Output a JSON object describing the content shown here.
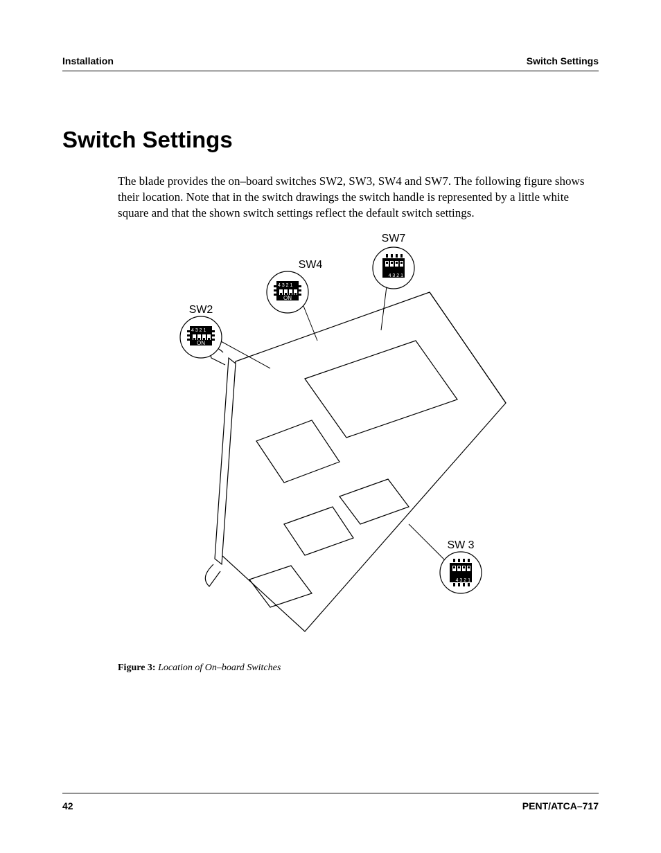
{
  "header": {
    "left": "Installation",
    "right": "Switch Settings"
  },
  "title": "Switch Settings",
  "paragraph": "The blade provides the on–board switches SW2, SW3, SW4 and SW7. The following figure shows their location. Note that in the switch drawings the switch handle is represented by a little white square and that the shown switch settings reflect the default switch settings.",
  "figure": {
    "labels": {
      "sw7": "SW7",
      "sw4": "SW4",
      "sw2": "SW2",
      "sw3": "SW 3"
    },
    "switch_positions": [
      "1",
      "2",
      "3",
      "4"
    ],
    "switch_on_label": "ON",
    "caption_label": "Figure 3:",
    "caption_text": "Location of On–board Switches"
  },
  "footer": {
    "page": "42",
    "doc": "PENT/ATCA–717"
  }
}
